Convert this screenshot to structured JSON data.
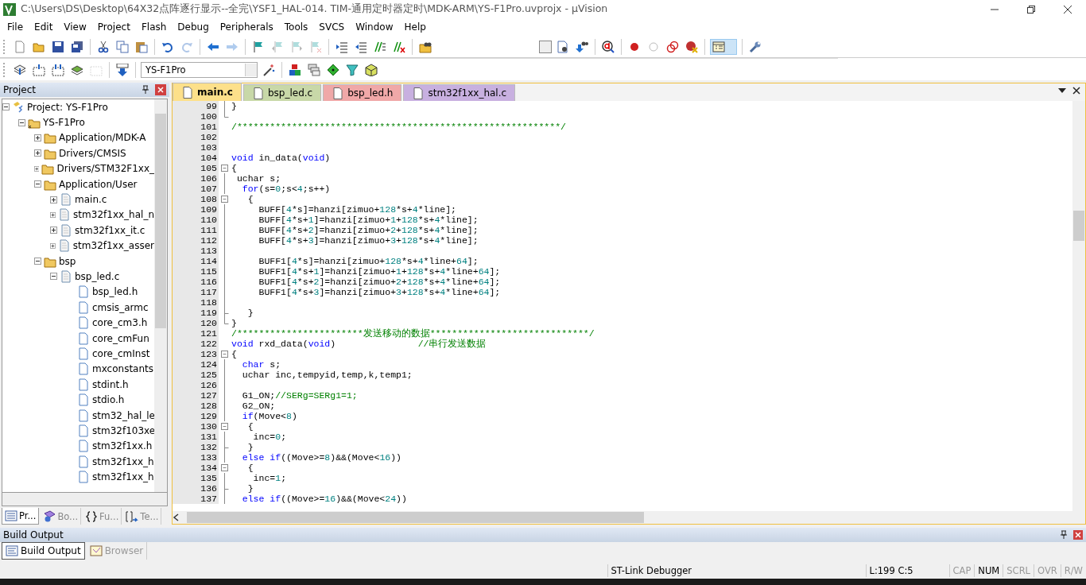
{
  "window": {
    "title": "C:\\Users\\DS\\Desktop\\64X32点阵逐行显示--全完\\YSF1_HAL-014. TIM-通用定时器定时\\MDK-ARM\\YS-F1Pro.uvprojx - µVision"
  },
  "menu": [
    "File",
    "Edit",
    "View",
    "Project",
    "Flash",
    "Debug",
    "Peripherals",
    "Tools",
    "SVCS",
    "Window",
    "Help"
  ],
  "toolbar_1": [
    {
      "kind": "new",
      "disabled": false
    },
    {
      "kind": "open",
      "disabled": false
    },
    {
      "kind": "save",
      "disabled": false
    },
    {
      "kind": "save-all",
      "disabled": false
    },
    {
      "kind": "separator"
    },
    {
      "kind": "cut",
      "disabled": false
    },
    {
      "kind": "copy",
      "disabled": false
    },
    {
      "kind": "paste",
      "disabled": false
    },
    {
      "kind": "separator"
    },
    {
      "kind": "undo",
      "disabled": false
    },
    {
      "kind": "redo",
      "disabled": true
    },
    {
      "kind": "separator"
    },
    {
      "kind": "back",
      "disabled": false
    },
    {
      "kind": "forward",
      "disabled": true
    },
    {
      "kind": "separator"
    },
    {
      "kind": "bookmark",
      "disabled": false
    },
    {
      "kind": "bookmark-prev",
      "disabled": true
    },
    {
      "kind": "bookmark-next",
      "disabled": true
    },
    {
      "kind": "bookmark-clear",
      "disabled": true
    },
    {
      "kind": "separator"
    },
    {
      "kind": "indent",
      "disabled": false
    },
    {
      "kind": "unindent",
      "disabled": false
    },
    {
      "kind": "comment",
      "disabled": false
    },
    {
      "kind": "uncomment",
      "disabled": false
    },
    {
      "kind": "separator"
    },
    {
      "kind": "find-files",
      "disabled": false
    },
    {
      "kind": "spacer"
    },
    {
      "kind": "combo"
    },
    {
      "kind": "find",
      "disabled": false
    },
    {
      "kind": "find-ref",
      "disabled": false
    },
    {
      "kind": "separator"
    },
    {
      "kind": "debug",
      "disabled": false
    },
    {
      "kind": "separator"
    },
    {
      "kind": "breakpoint",
      "disabled": false
    },
    {
      "kind": "breakpoint-off",
      "disabled": false
    },
    {
      "kind": "breakpoints",
      "disabled": false
    },
    {
      "kind": "breakpoint-kill",
      "disabled": false
    },
    {
      "kind": "separator"
    },
    {
      "kind": "windows",
      "disabled": false
    },
    {
      "kind": "separator"
    },
    {
      "kind": "config",
      "disabled": false
    }
  ],
  "toolbar_2": [
    {
      "kind": "translate",
      "disabled": false
    },
    {
      "kind": "build",
      "disabled": false
    },
    {
      "kind": "rebuild",
      "disabled": false
    },
    {
      "kind": "batch",
      "disabled": false
    },
    {
      "kind": "stop",
      "disabled": true
    },
    {
      "kind": "separator"
    },
    {
      "kind": "load",
      "disabled": false
    },
    {
      "kind": "separator"
    },
    {
      "kind": "target"
    },
    {
      "kind": "wand",
      "disabled": false
    },
    {
      "kind": "separator"
    },
    {
      "kind": "cubes",
      "disabled": false
    },
    {
      "kind": "layers",
      "disabled": false
    },
    {
      "kind": "diamond",
      "disabled": false
    },
    {
      "kind": "funnel",
      "disabled": false
    },
    {
      "kind": "pack",
      "disabled": false
    }
  ],
  "target": {
    "value": "YS-F1Pro"
  },
  "project_panel": {
    "title": "Project",
    "tree": [
      {
        "label": "Project: YS-F1Pro",
        "kind": "project",
        "expanded": true,
        "children": [
          {
            "label": "YS-F1Pro",
            "kind": "target",
            "expanded": true,
            "children": [
              {
                "label": "Application/MDK-A",
                "kind": "folder",
                "expanded": false
              },
              {
                "label": "Drivers/CMSIS",
                "kind": "folder",
                "expanded": false
              },
              {
                "label": "Drivers/STM32F1xx_",
                "kind": "folder",
                "expanded": false
              },
              {
                "label": "Application/User",
                "kind": "folder",
                "expanded": true,
                "children": [
                  {
                    "label": "main.c",
                    "kind": "source",
                    "expanded": false
                  },
                  {
                    "label": "stm32f1xx_hal_n",
                    "kind": "source",
                    "expanded": false
                  },
                  {
                    "label": "stm32f1xx_it.c",
                    "kind": "source",
                    "expanded": false
                  },
                  {
                    "label": "stm32f1xx_asser",
                    "kind": "source",
                    "expanded": false
                  }
                ]
              },
              {
                "label": "bsp",
                "kind": "folder",
                "expanded": true,
                "children": [
                  {
                    "label": "bsp_led.c",
                    "kind": "source",
                    "expanded": true,
                    "children": [
                      {
                        "label": "bsp_led.h",
                        "kind": "header"
                      },
                      {
                        "label": "cmsis_armc",
                        "kind": "header"
                      },
                      {
                        "label": "core_cm3.h",
                        "kind": "header"
                      },
                      {
                        "label": "core_cmFun",
                        "kind": "header"
                      },
                      {
                        "label": "core_cmInst",
                        "kind": "header"
                      },
                      {
                        "label": "mxconstants",
                        "kind": "header"
                      },
                      {
                        "label": "stdint.h",
                        "kind": "header"
                      },
                      {
                        "label": "stdio.h",
                        "kind": "header"
                      },
                      {
                        "label": "stm32_hal_le",
                        "kind": "header"
                      },
                      {
                        "label": "stm32f103xe",
                        "kind": "header"
                      },
                      {
                        "label": "stm32f1xx.h",
                        "kind": "header"
                      },
                      {
                        "label": "stm32f1xx_h",
                        "kind": "header"
                      },
                      {
                        "label": "stm32f1xx_h",
                        "kind": "header"
                      }
                    ]
                  }
                ]
              }
            ]
          }
        ]
      }
    ],
    "tabs": [
      {
        "label": "Pr...",
        "kind": "project",
        "selected": true
      },
      {
        "label": "Bo...",
        "kind": "books",
        "selected": false
      },
      {
        "label": "Fu...",
        "kind": "functions",
        "selected": false
      },
      {
        "label": "Te...",
        "kind": "templates",
        "selected": false
      }
    ]
  },
  "editor": {
    "tabs": [
      {
        "label": "main.c",
        "selected": true,
        "color": "#fde08a"
      },
      {
        "label": "bsp_led.c",
        "selected": false,
        "color": "#c8d8a8"
      },
      {
        "label": "bsp_led.h",
        "selected": false,
        "color": "#f0a8a8"
      },
      {
        "label": "stm32f1xx_hal.c",
        "selected": false,
        "color": "#c8b0e0"
      }
    ],
    "lines": [
      {
        "number": "99",
        "kind": "line",
        "parts": [
          {
            "kind": "plain",
            "text": "}"
          }
        ]
      },
      {
        "number": "100",
        "kind": "end"
      },
      {
        "number": "101",
        "kind": "none",
        "parts": [
          {
            "kind": "comment",
            "text": "/***********************************************************/"
          }
        ]
      },
      {
        "number": "102",
        "kind": "none"
      },
      {
        "number": "103",
        "kind": "none"
      },
      {
        "number": "104",
        "kind": "none",
        "parts": [
          {
            "kind": "keyword",
            "text": "void"
          },
          {
            "kind": "plain",
            "text": " in_data("
          },
          {
            "kind": "keyword",
            "text": "void"
          },
          {
            "kind": "plain",
            "text": ")"
          }
        ]
      },
      {
        "number": "105",
        "kind": "open",
        "parts": [
          {
            "kind": "plain",
            "text": "{"
          }
        ]
      },
      {
        "number": "106",
        "kind": "line",
        "parts": [
          {
            "kind": "plain",
            "text": " uchar s;"
          }
        ]
      },
      {
        "number": "107",
        "kind": "line",
        "parts": [
          {
            "kind": "keyword",
            "text": "  for"
          },
          {
            "kind": "plain",
            "text": "(s="
          },
          {
            "kind": "number",
            "text": "0"
          },
          {
            "kind": "plain",
            "text": ";s<"
          },
          {
            "kind": "number",
            "text": "4"
          },
          {
            "kind": "plain",
            "text": ";s++)"
          }
        ]
      },
      {
        "number": "108",
        "kind": "open",
        "parts": [
          {
            "kind": "plain",
            "text": "   {"
          }
        ]
      },
      {
        "number": "109",
        "kind": "line",
        "parts": [
          {
            "kind": "plain",
            "text": "     BUFF["
          },
          {
            "kind": "number",
            "text": "4"
          },
          {
            "kind": "plain",
            "text": "*s]=hanzi[zimuo+"
          },
          {
            "kind": "number",
            "text": "128"
          },
          {
            "kind": "plain",
            "text": "*s+"
          },
          {
            "kind": "number",
            "text": "4"
          },
          {
            "kind": "plain",
            "text": "*line];"
          }
        ]
      },
      {
        "number": "110",
        "kind": "line",
        "parts": [
          {
            "kind": "plain",
            "text": "     BUFF["
          },
          {
            "kind": "number",
            "text": "4"
          },
          {
            "kind": "plain",
            "text": "*s+"
          },
          {
            "kind": "number",
            "text": "1"
          },
          {
            "kind": "plain",
            "text": "]=hanzi[zimuo+"
          },
          {
            "kind": "number",
            "text": "1"
          },
          {
            "kind": "plain",
            "text": "+"
          },
          {
            "kind": "number",
            "text": "128"
          },
          {
            "kind": "plain",
            "text": "*s+"
          },
          {
            "kind": "number",
            "text": "4"
          },
          {
            "kind": "plain",
            "text": "*line];"
          }
        ]
      },
      {
        "number": "111",
        "kind": "line",
        "parts": [
          {
            "kind": "plain",
            "text": "     BUFF["
          },
          {
            "kind": "number",
            "text": "4"
          },
          {
            "kind": "plain",
            "text": "*s+"
          },
          {
            "kind": "number",
            "text": "2"
          },
          {
            "kind": "plain",
            "text": "]=hanzi[zimuo+"
          },
          {
            "kind": "number",
            "text": "2"
          },
          {
            "kind": "plain",
            "text": "+"
          },
          {
            "kind": "number",
            "text": "128"
          },
          {
            "kind": "plain",
            "text": "*s+"
          },
          {
            "kind": "number",
            "text": "4"
          },
          {
            "kind": "plain",
            "text": "*line];"
          }
        ]
      },
      {
        "number": "112",
        "kind": "line",
        "parts": [
          {
            "kind": "plain",
            "text": "     BUFF["
          },
          {
            "kind": "number",
            "text": "4"
          },
          {
            "kind": "plain",
            "text": "*s+"
          },
          {
            "kind": "number",
            "text": "3"
          },
          {
            "kind": "plain",
            "text": "]=hanzi[zimuo+"
          },
          {
            "kind": "number",
            "text": "3"
          },
          {
            "kind": "plain",
            "text": "+"
          },
          {
            "kind": "number",
            "text": "128"
          },
          {
            "kind": "plain",
            "text": "*s+"
          },
          {
            "kind": "number",
            "text": "4"
          },
          {
            "kind": "plain",
            "text": "*line];"
          }
        ]
      },
      {
        "number": "113",
        "kind": "line"
      },
      {
        "number": "114",
        "kind": "line",
        "parts": [
          {
            "kind": "plain",
            "text": "     BUFF1["
          },
          {
            "kind": "number",
            "text": "4"
          },
          {
            "kind": "plain",
            "text": "*s]=hanzi[zimuo+"
          },
          {
            "kind": "number",
            "text": "128"
          },
          {
            "kind": "plain",
            "text": "*s+"
          },
          {
            "kind": "number",
            "text": "4"
          },
          {
            "kind": "plain",
            "text": "*line+"
          },
          {
            "kind": "number",
            "text": "64"
          },
          {
            "kind": "plain",
            "text": "];"
          }
        ]
      },
      {
        "number": "115",
        "kind": "line",
        "parts": [
          {
            "kind": "plain",
            "text": "     BUFF1["
          },
          {
            "kind": "number",
            "text": "4"
          },
          {
            "kind": "plain",
            "text": "*s+"
          },
          {
            "kind": "number",
            "text": "1"
          },
          {
            "kind": "plain",
            "text": "]=hanzi[zimuo+"
          },
          {
            "kind": "number",
            "text": "1"
          },
          {
            "kind": "plain",
            "text": "+"
          },
          {
            "kind": "number",
            "text": "128"
          },
          {
            "kind": "plain",
            "text": "*s+"
          },
          {
            "kind": "number",
            "text": "4"
          },
          {
            "kind": "plain",
            "text": "*line+"
          },
          {
            "kind": "number",
            "text": "64"
          },
          {
            "kind": "plain",
            "text": "];"
          }
        ]
      },
      {
        "number": "116",
        "kind": "line",
        "parts": [
          {
            "kind": "plain",
            "text": "     BUFF1["
          },
          {
            "kind": "number",
            "text": "4"
          },
          {
            "kind": "plain",
            "text": "*s+"
          },
          {
            "kind": "number",
            "text": "2"
          },
          {
            "kind": "plain",
            "text": "]=hanzi[zimuo+"
          },
          {
            "kind": "number",
            "text": "2"
          },
          {
            "kind": "plain",
            "text": "+"
          },
          {
            "kind": "number",
            "text": "128"
          },
          {
            "kind": "plain",
            "text": "*s+"
          },
          {
            "kind": "number",
            "text": "4"
          },
          {
            "kind": "plain",
            "text": "*line+"
          },
          {
            "kind": "number",
            "text": "64"
          },
          {
            "kind": "plain",
            "text": "];"
          }
        ]
      },
      {
        "number": "117",
        "kind": "line",
        "parts": [
          {
            "kind": "plain",
            "text": "     BUFF1["
          },
          {
            "kind": "number",
            "text": "4"
          },
          {
            "kind": "plain",
            "text": "*s+"
          },
          {
            "kind": "number",
            "text": "3"
          },
          {
            "kind": "plain",
            "text": "]=hanzi[zimuo+"
          },
          {
            "kind": "number",
            "text": "3"
          },
          {
            "kind": "plain",
            "text": "+"
          },
          {
            "kind": "number",
            "text": "128"
          },
          {
            "kind": "plain",
            "text": "*s+"
          },
          {
            "kind": "number",
            "text": "4"
          },
          {
            "kind": "plain",
            "text": "*line+"
          },
          {
            "kind": "number",
            "text": "64"
          },
          {
            "kind": "plain",
            "text": "];"
          }
        ]
      },
      {
        "number": "118",
        "kind": "line"
      },
      {
        "number": "119",
        "kind": "branch",
        "parts": [
          {
            "kind": "plain",
            "text": "   }"
          }
        ]
      },
      {
        "number": "120",
        "kind": "end",
        "parts": [
          {
            "kind": "plain",
            "text": "}"
          }
        ]
      },
      {
        "number": "121",
        "kind": "none",
        "parts": [
          {
            "kind": "comment",
            "text": "/***********************发送移动的数据*****************************/"
          }
        ]
      },
      {
        "number": "122",
        "kind": "none",
        "parts": [
          {
            "kind": "keyword",
            "text": "void"
          },
          {
            "kind": "plain",
            "text": " rxd_data("
          },
          {
            "kind": "keyword",
            "text": "void"
          },
          {
            "kind": "plain",
            "text": ")               "
          },
          {
            "kind": "comment",
            "text": "//串行发送数据"
          }
        ]
      },
      {
        "number": "123",
        "kind": "open",
        "parts": [
          {
            "kind": "plain",
            "text": "{"
          }
        ]
      },
      {
        "number": "124",
        "kind": "line",
        "parts": [
          {
            "kind": "keyword",
            "text": "  char"
          },
          {
            "kind": "plain",
            "text": " s;"
          }
        ]
      },
      {
        "number": "125",
        "kind": "line",
        "parts": [
          {
            "kind": "plain",
            "text": "  uchar inc,tempyid,temp,k,temp1;"
          }
        ]
      },
      {
        "number": "126",
        "kind": "line"
      },
      {
        "number": "127",
        "kind": "line",
        "parts": [
          {
            "kind": "plain",
            "text": "  G1_ON;"
          },
          {
            "kind": "comment",
            "text": "//SERg=SERg1=1;"
          }
        ]
      },
      {
        "number": "128",
        "kind": "line",
        "parts": [
          {
            "kind": "plain",
            "text": "  G2_ON;"
          }
        ]
      },
      {
        "number": "129",
        "kind": "line",
        "parts": [
          {
            "kind": "keyword",
            "text": "  if"
          },
          {
            "kind": "plain",
            "text": "(Move<"
          },
          {
            "kind": "number",
            "text": "8"
          },
          {
            "kind": "plain",
            "text": ")"
          }
        ]
      },
      {
        "number": "130",
        "kind": "open",
        "parts": [
          {
            "kind": "plain",
            "text": "   {"
          }
        ]
      },
      {
        "number": "131",
        "kind": "line",
        "parts": [
          {
            "kind": "plain",
            "text": "    inc="
          },
          {
            "kind": "number",
            "text": "0"
          },
          {
            "kind": "plain",
            "text": ";"
          }
        ]
      },
      {
        "number": "132",
        "kind": "branch",
        "parts": [
          {
            "kind": "plain",
            "text": "   }"
          }
        ]
      },
      {
        "number": "133",
        "kind": "line",
        "parts": [
          {
            "kind": "keyword",
            "text": "  else if"
          },
          {
            "kind": "plain",
            "text": "((Move>="
          },
          {
            "kind": "number",
            "text": "8"
          },
          {
            "kind": "plain",
            "text": ")&&(Move<"
          },
          {
            "kind": "number",
            "text": "16"
          },
          {
            "kind": "plain",
            "text": "))"
          }
        ]
      },
      {
        "number": "134",
        "kind": "open",
        "parts": [
          {
            "kind": "plain",
            "text": "   {"
          }
        ]
      },
      {
        "number": "135",
        "kind": "line",
        "parts": [
          {
            "kind": "plain",
            "text": "    inc="
          },
          {
            "kind": "number",
            "text": "1"
          },
          {
            "kind": "plain",
            "text": ";"
          }
        ]
      },
      {
        "number": "136",
        "kind": "branch",
        "parts": [
          {
            "kind": "plain",
            "text": "   }"
          }
        ]
      },
      {
        "number": "137",
        "kind": "line",
        "parts": [
          {
            "kind": "keyword",
            "text": "  else if"
          },
          {
            "kind": "plain",
            "text": "((Move>="
          },
          {
            "kind": "number",
            "text": "16"
          },
          {
            "kind": "plain",
            "text": ")&&(Move<"
          },
          {
            "kind": "number",
            "text": "24"
          },
          {
            "kind": "plain",
            "text": "))"
          }
        ]
      }
    ]
  },
  "build_output": {
    "title": "Build Output",
    "tabs": [
      {
        "label": "Build Output",
        "selected": true
      },
      {
        "label": "Browser",
        "selected": false
      }
    ]
  },
  "status_bar": {
    "debugger": "ST-Link Debugger",
    "position": "L:199 C:5",
    "indicators": [
      {
        "label": "CAP",
        "on": false
      },
      {
        "label": "NUM",
        "on": true
      },
      {
        "label": "SCRL",
        "on": false
      },
      {
        "label": "OVR",
        "on": false
      },
      {
        "label": "R/W",
        "on": false
      }
    ]
  }
}
